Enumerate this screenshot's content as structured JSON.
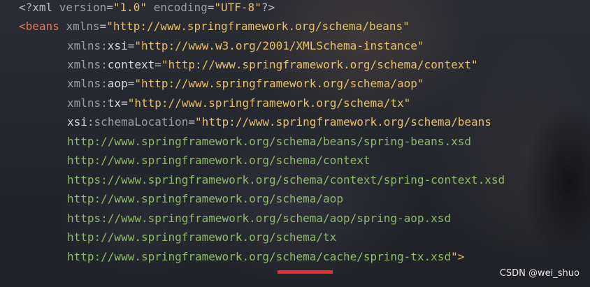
{
  "colors": {
    "background": "#23262c",
    "tag": "#e07a5f",
    "string": "#e6c16a",
    "url": "#90b96a",
    "attribute": "#9aa0a8",
    "highlight_underline": "#e5302d"
  },
  "code": {
    "line1": {
      "open": "<?xml ",
      "version_attr": "version",
      "eq1": "=",
      "version_val": "\"1.0\"",
      "sp": " ",
      "encoding_attr": "encoding",
      "eq2": "=",
      "encoding_val": "\"UTF-8\"",
      "close": "?>"
    },
    "line2": {
      "lt": "<",
      "tag": "beans",
      "sp": " ",
      "attr": "xmlns",
      "eq": "=",
      "val": "\"http://www.springframework.org/schema/beans\""
    },
    "line3": {
      "prefix": "xmlns:",
      "ns": "xsi",
      "eq": "=",
      "val": "\"http://www.w3.org/2001/XMLSchema-instance\""
    },
    "line4": {
      "prefix": "xmlns:",
      "ns": "context",
      "eq": "=",
      "val": "\"http://www.springframework.org/schema/context\""
    },
    "line5": {
      "prefix": "xmlns:",
      "ns": "aop",
      "eq": "=",
      "val": "\"http://www.springframework.org/schema/aop\""
    },
    "line6": {
      "prefix": "xmlns:",
      "ns": "tx",
      "eq": "=",
      "val": "\"http://www.springframework.org/schema/tx\""
    },
    "line7": {
      "ns": "xsi",
      "colon": ":",
      "attr": "schemaLocation",
      "eq": "=",
      "val": "\"http://www.springframework.org/schema/beans"
    },
    "line8": "http://www.springframework.org/schema/beans/spring-beans.xsd",
    "line9": "http://www.springframework.org/schema/context",
    "line10": "https://www.springframework.org/schema/context/spring-context.xsd",
    "line11": "http://www.springframework.org/schema/aop",
    "line12": "https://www.springframework.org/schema/aop/spring-aop.xsd",
    "line13": "http://www.springframework.org/schema/tx",
    "line14": {
      "url": "http://www.springframework.org/schema/cache/spring-tx.xsd",
      "end": "\">"
    }
  },
  "watermark": "CSDN @wei_shuo"
}
